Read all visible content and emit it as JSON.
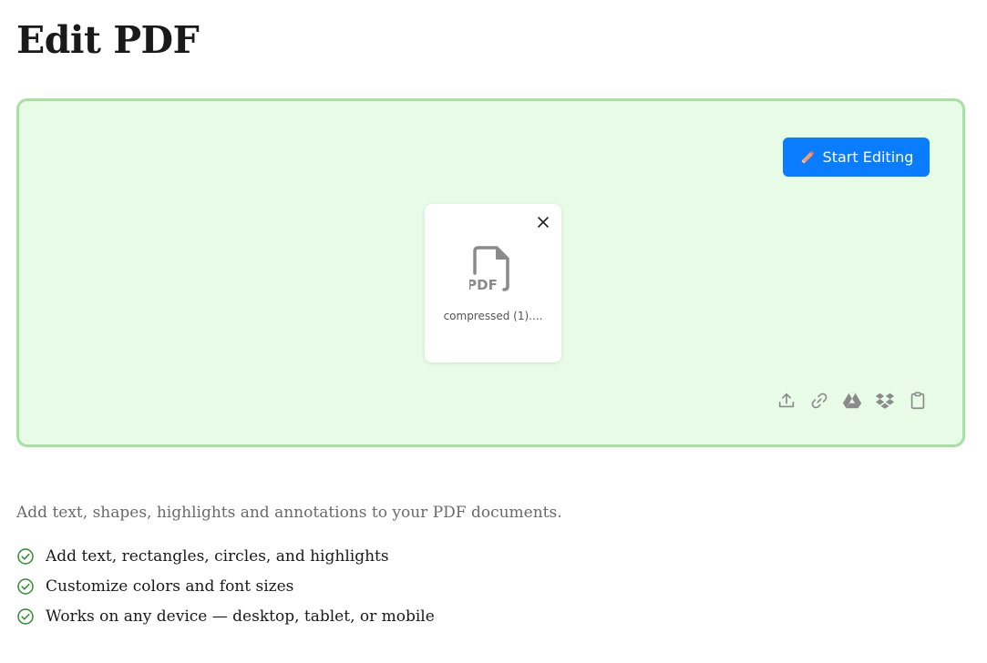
{
  "page": {
    "title": "Edit PDF",
    "description": "Add text, shapes, highlights and annotations to your PDF documents."
  },
  "dropzone": {
    "start_button_label": "Start Editing",
    "file": {
      "name": "compressed (1)....",
      "icon_label": "PDF"
    },
    "source_icons": [
      "upload-icon",
      "link-icon",
      "google-drive-icon",
      "dropbox-icon",
      "clipboard-icon"
    ]
  },
  "features": [
    "Add text, rectangles, circles, and highlights",
    "Customize colors and font sizes",
    "Works on any device — desktop, tablet, or mobile"
  ],
  "colors": {
    "accent": "#0a7cff",
    "dropzone_bg": "#e8fbe7",
    "dropzone_border": "#a6e0a2",
    "check": "#2e8b2e"
  }
}
